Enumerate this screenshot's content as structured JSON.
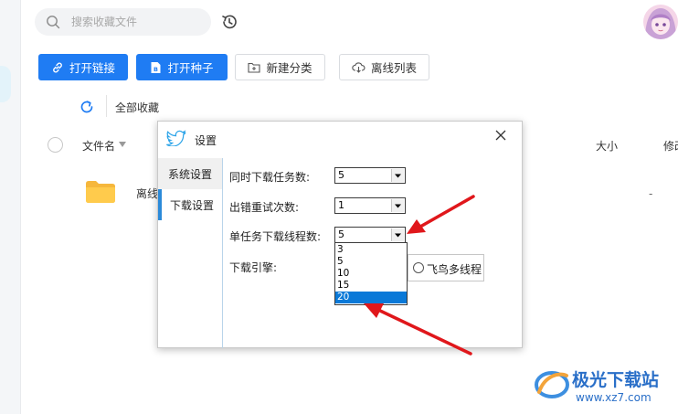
{
  "search": {
    "placeholder": "搜索收藏文件"
  },
  "toolbar": {
    "open_link": "打开链接",
    "open_seed": "打开种子",
    "new_category": "新建分类",
    "offline_list": "离线列表"
  },
  "breadcrumb": {
    "all_favorites": "全部收藏"
  },
  "table": {
    "columns": {
      "file_name": "文件名",
      "size": "大小",
      "modified": "修改"
    },
    "rows": [
      {
        "name": "离线",
        "size": "-"
      }
    ]
  },
  "dialog": {
    "title": "设置",
    "nav": {
      "system": "系统设置",
      "download": "下载设置"
    },
    "fields": {
      "concurrent_tasks": {
        "label": "同时下载任务数:",
        "value": "5"
      },
      "retry_count": {
        "label": "出错重试次数:",
        "value": "1"
      },
      "threads_per_task": {
        "label": "单任务下载线程数:",
        "value": "5"
      },
      "engine": {
        "label": "下载引擎:"
      }
    },
    "thread_options": [
      "3",
      "5",
      "10",
      "15",
      "20"
    ],
    "highlighted_option": "20",
    "engine_option": "飞鸟多线程"
  },
  "watermark": {
    "brand": "极光下载站",
    "url": "www.xz7.com"
  },
  "colors": {
    "primary": "#1f7cf3",
    "annotation_arrow": "#e0171b",
    "selection": "#0a79d8"
  }
}
